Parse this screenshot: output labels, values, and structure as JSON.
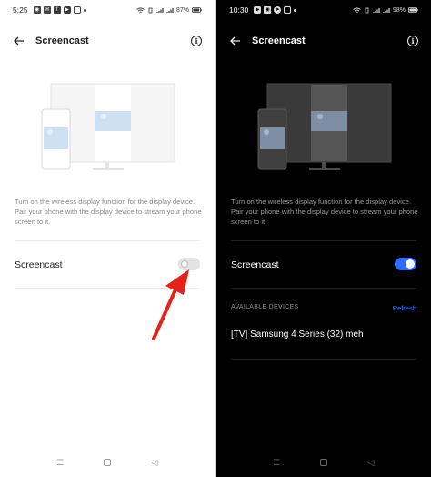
{
  "light": {
    "status": {
      "time": "5:25",
      "icons": [
        "notif-a",
        "notif-b",
        "facebook",
        "youtube",
        "instagram",
        "dot"
      ],
      "battery": "87%"
    },
    "appbar": {
      "title": "Screencast"
    },
    "description": "Turn on the wireless display function for the display device. Pair your phone with the display device to stream your phone screen to it.",
    "screencast_label": "Screencast",
    "toggle_on": false
  },
  "dark": {
    "status": {
      "time": "10:30",
      "icons": [
        "youtube",
        "notif-c",
        "telegram",
        "instagram",
        "dot"
      ],
      "battery": "98%"
    },
    "appbar": {
      "title": "Screencast"
    },
    "description": "Turn on the wireless display function for the display device. Pair your phone with the display device to stream your phone screen to it.",
    "screencast_label": "Screencast",
    "toggle_on": true,
    "available_devices": {
      "heading": "AVAILABLE DEVICES",
      "refresh_label": "Refresh",
      "items": [
        "[TV] Samsung 4 Series (32) meh"
      ]
    }
  },
  "colors": {
    "accent": "#2f6bff",
    "link": "#2f7bff",
    "annotation_arrow": "#e2231a"
  }
}
